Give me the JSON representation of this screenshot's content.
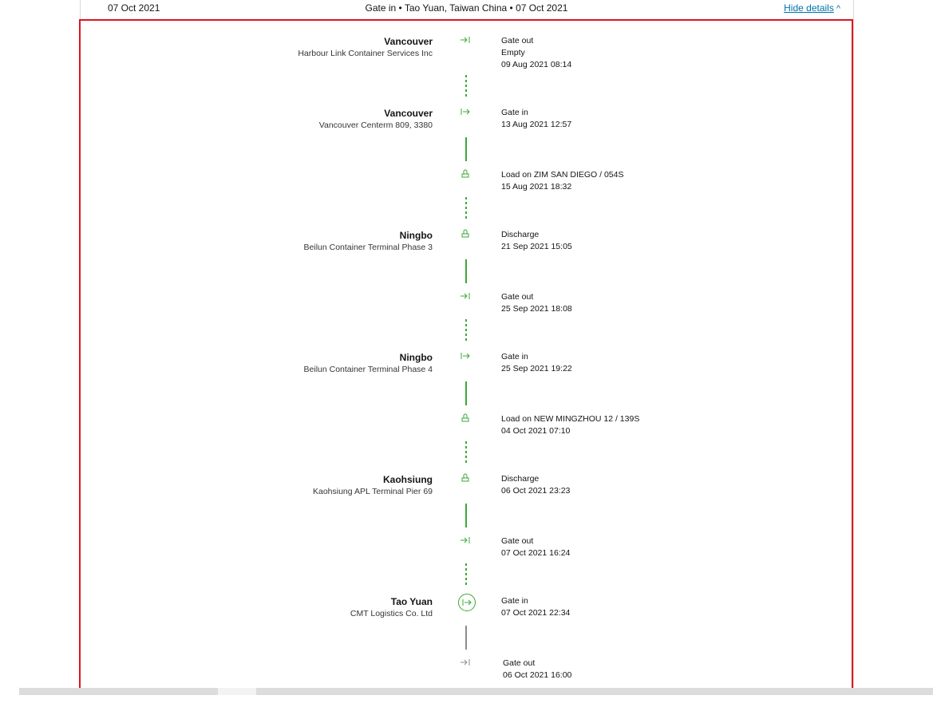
{
  "summary": {
    "date": "07 Oct 2021",
    "event": "Gate in • Tao Yuan, Taiwan China • 07 Oct 2021",
    "toggle_label": "Hide details",
    "toggle_icon": "chevron-up-icon"
  },
  "timeline": [
    {
      "location": "Vancouver",
      "terminal": "Harbour Link Container Services Inc",
      "icon": "gate-out-icon",
      "lines": [
        "Gate out",
        "Empty",
        "09 Aug 2021 08:14"
      ]
    },
    {
      "location": "Vancouver",
      "terminal": "Vancouver Centerm 809, 3380",
      "icon": "gate-in-icon",
      "lines": [
        "Gate in",
        "13 Aug 2021 12:57"
      ]
    },
    {
      "location": "",
      "terminal": "",
      "icon": "load-icon",
      "lines": [
        "Load on ZIM SAN DIEGO / 054S",
        "15 Aug 2021 18:32"
      ]
    },
    {
      "location": "Ningbo",
      "terminal": "Beilun Container Terminal Phase 3",
      "icon": "discharge-icon",
      "lines": [
        "Discharge",
        "21 Sep 2021 15:05"
      ]
    },
    {
      "location": "",
      "terminal": "",
      "icon": "gate-out-icon",
      "lines": [
        "Gate out",
        "25 Sep 2021 18:08"
      ]
    },
    {
      "location": "Ningbo",
      "terminal": "Beilun Container Terminal Phase 4",
      "icon": "gate-in-icon",
      "lines": [
        "Gate in",
        "25 Sep 2021 19:22"
      ]
    },
    {
      "location": "",
      "terminal": "",
      "icon": "load-icon",
      "lines": [
        "Load on NEW MINGZHOU 12 / 139S",
        "04 Oct 2021 07:10"
      ]
    },
    {
      "location": "Kaohsiung",
      "terminal": "Kaohsiung APL Terminal Pier 69",
      "icon": "discharge-icon",
      "lines": [
        "Discharge",
        "06 Oct 2021 23:23"
      ]
    },
    {
      "location": "",
      "terminal": "",
      "icon": "gate-out-icon",
      "lines": [
        "Gate out",
        "07 Oct 2021 16:24"
      ]
    },
    {
      "location": "Tao Yuan",
      "terminal": "CMT Logistics Co. Ltd",
      "icon": "gate-in-icon",
      "lines": [
        "Gate in",
        "07 Oct 2021 22:34"
      ]
    },
    {
      "location": "",
      "terminal": "",
      "icon": "gate-out-icon",
      "lines": [
        "Gate out",
        "06 Oct 2021 16:00"
      ]
    }
  ],
  "colors": {
    "completed": "#3aa836",
    "future": "#8c8c8c",
    "highlight_border": "#e0141e",
    "link": "#0073ab"
  }
}
